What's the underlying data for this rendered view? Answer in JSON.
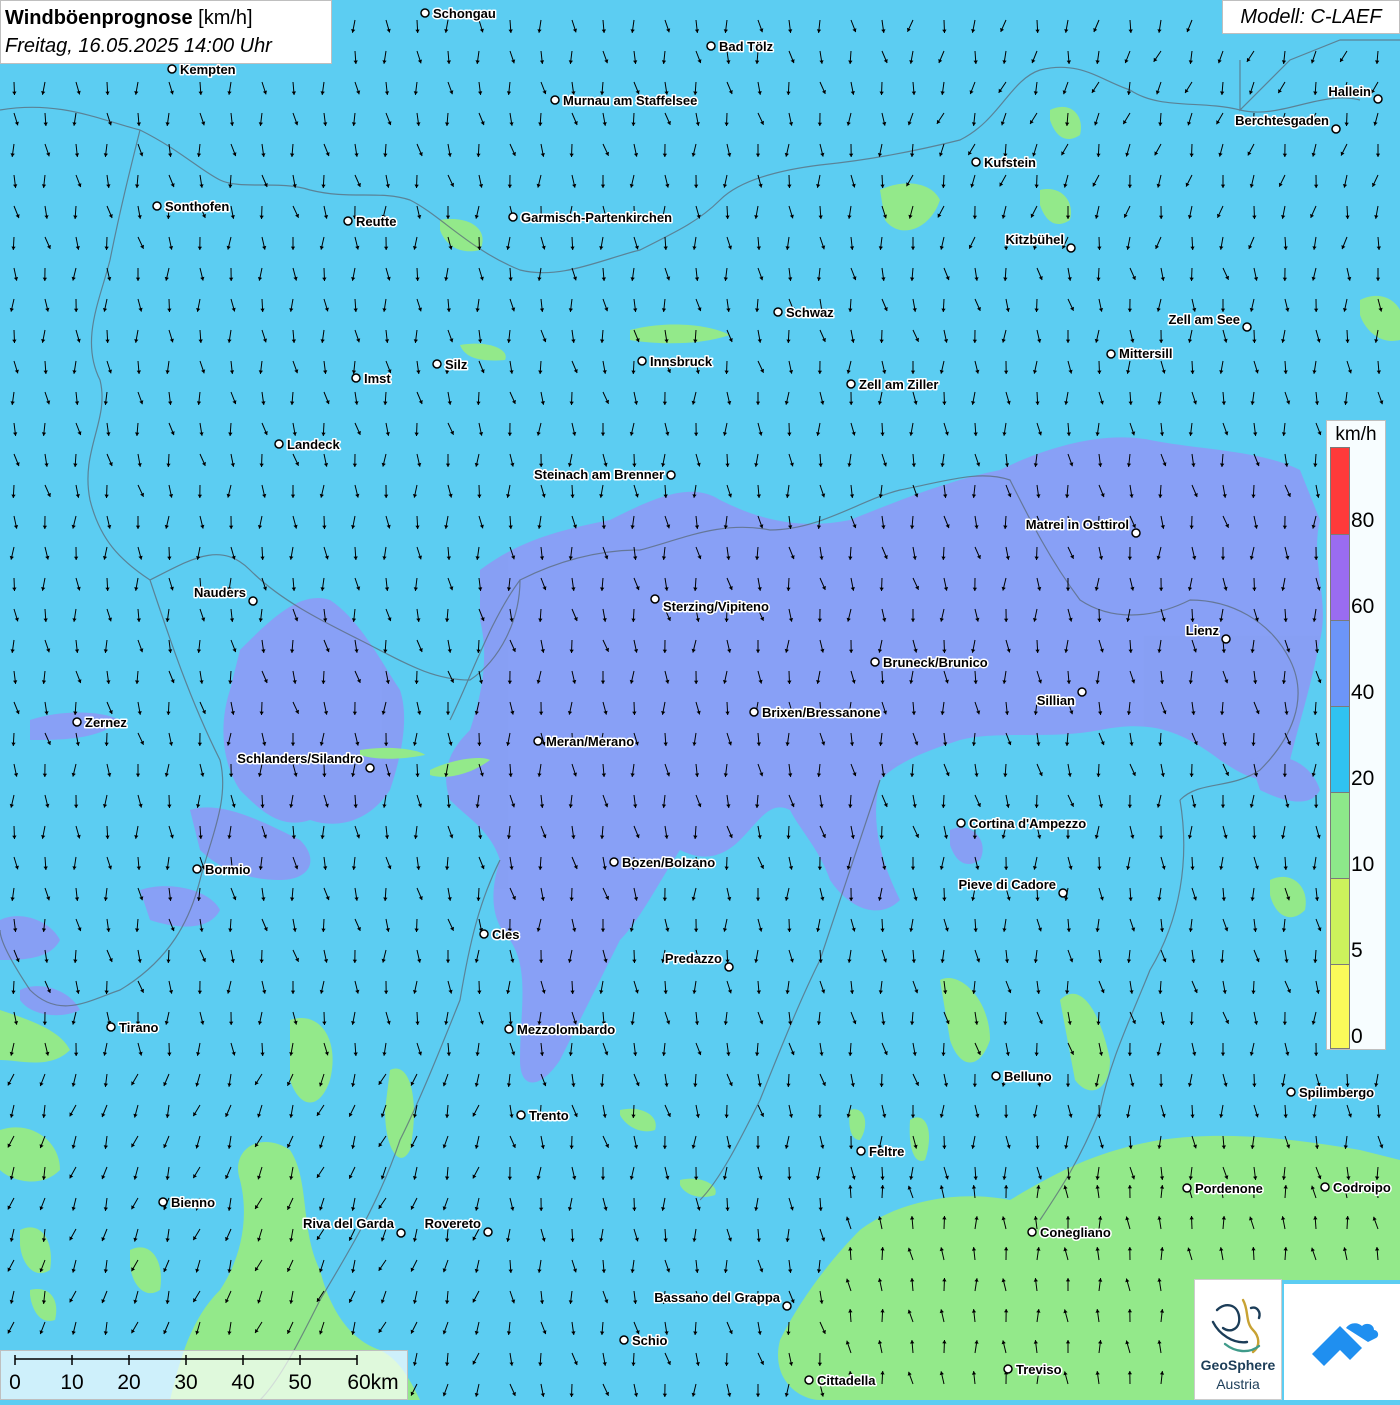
{
  "title": {
    "main": "Windböenprognose",
    "unit": "[km/h]",
    "datetime": "Freitag, 16.05.2025 14:00 Uhr"
  },
  "model": "Modell: C-LAEF",
  "colors": {
    "background": "#5ccdf2",
    "band_40_60": "#8a9df5",
    "band_10_20": "#93e98a",
    "band_5_10": "#d7f25a",
    "band_0_5": "#fafa5a",
    "band_60_80": "#9a6cf0",
    "band_80_plus": "#ff3a3a"
  },
  "legend": {
    "unit": "km/h",
    "ticks": [
      "80",
      "60",
      "40",
      "20",
      "10",
      "5",
      "0"
    ],
    "segment_colors": [
      "#ff3a3a",
      "#9a6cf0",
      "#6c95f8",
      "#30c2f0",
      "#8de88a",
      "#ccf25c",
      "#fafa5a"
    ]
  },
  "scale": {
    "labels": [
      "0",
      "10",
      "20",
      "30",
      "40",
      "50",
      "60km"
    ]
  },
  "logo": {
    "name1": "GeoSphere",
    "name2": "Austria",
    "icon": "geosphere-logo",
    "app_icon": "cloud-mountain-icon"
  },
  "cities": [
    {
      "name": "Schongau"
    },
    {
      "name": "Bad Tölz"
    },
    {
      "name": "Kempten"
    },
    {
      "name": "Murnau am Staffelsee"
    },
    {
      "name": "Hallein"
    },
    {
      "name": "Berchtesgaden"
    },
    {
      "name": "Kufstein"
    },
    {
      "name": "Sonthofen"
    },
    {
      "name": "Reutte"
    },
    {
      "name": "Garmisch-Partenkirchen"
    },
    {
      "name": "Kitzbühel"
    },
    {
      "name": "Schwaz"
    },
    {
      "name": "Zell am See"
    },
    {
      "name": "Mittersill"
    },
    {
      "name": "Innsbruck"
    },
    {
      "name": "Silz"
    },
    {
      "name": "Imst"
    },
    {
      "name": "Zell am Ziller"
    },
    {
      "name": "Landeck"
    },
    {
      "name": "Steinach am Brenner"
    },
    {
      "name": "Matrei in Osttirol"
    },
    {
      "name": "Nauders"
    },
    {
      "name": "Sterzing/Vipiteno"
    },
    {
      "name": "Lienz"
    },
    {
      "name": "Bruneck/Brunico"
    },
    {
      "name": "Sillian"
    },
    {
      "name": "Zernez"
    },
    {
      "name": "Brixen/Bressanone"
    },
    {
      "name": "Meran/Merano"
    },
    {
      "name": "Schlanders/Silandro"
    },
    {
      "name": "Cortina d'Ampezzo"
    },
    {
      "name": "Bozen/Bolzano"
    },
    {
      "name": "Bormio"
    },
    {
      "name": "Pieve di Cadore"
    },
    {
      "name": "Cles"
    },
    {
      "name": "Predazzo"
    },
    {
      "name": "Tirano"
    },
    {
      "name": "Mezzolombardo"
    },
    {
      "name": "Belluno"
    },
    {
      "name": "Spilimbergo"
    },
    {
      "name": "Trento"
    },
    {
      "name": "Feltre"
    },
    {
      "name": "Pordenone"
    },
    {
      "name": "Codroipo"
    },
    {
      "name": "Bienno"
    },
    {
      "name": "Riva del Garda"
    },
    {
      "name": "Rovereto"
    },
    {
      "name": "Conegliano"
    },
    {
      "name": "Bassano del Grappa"
    },
    {
      "name": "Schio"
    },
    {
      "name": "Treviso"
    },
    {
      "name": "Cittadella"
    }
  ]
}
